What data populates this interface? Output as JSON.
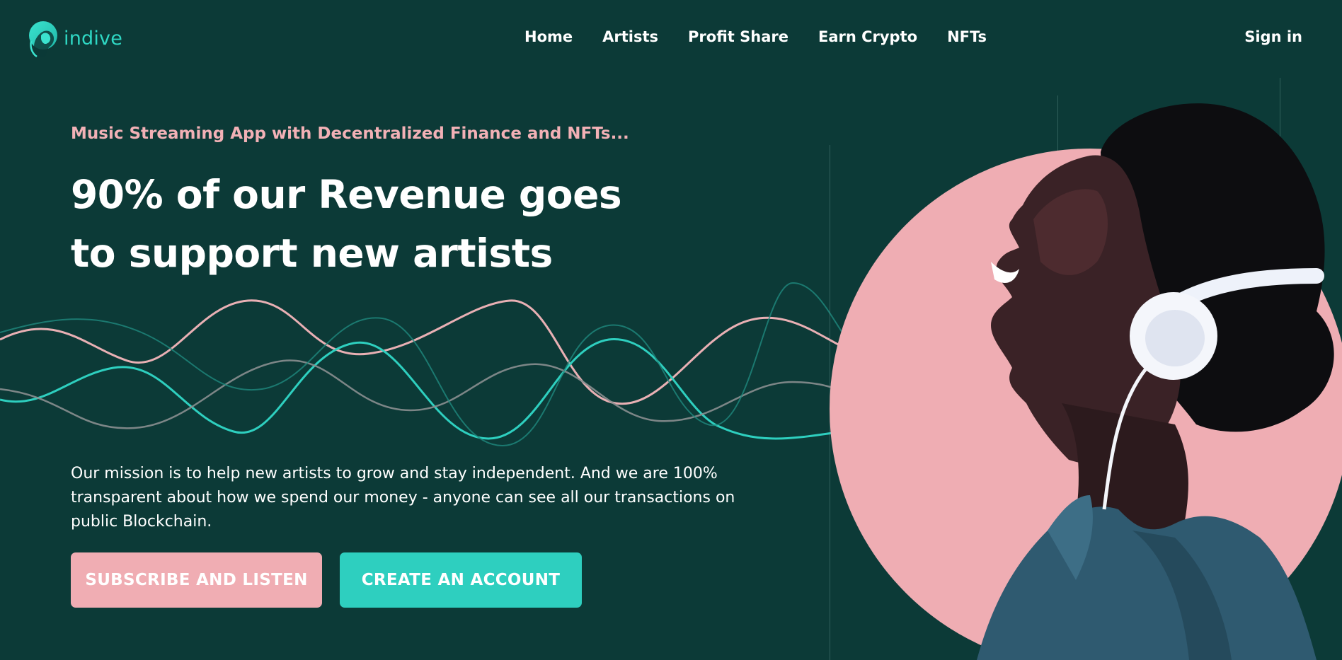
{
  "brand": {
    "name": "indive",
    "accent": "#2fd8c4",
    "pink": "#f0adb3",
    "background": "#0c3a37"
  },
  "nav": {
    "items": [
      {
        "label": "Home"
      },
      {
        "label": "Artists"
      },
      {
        "label": "Profit Share"
      },
      {
        "label": "Earn Crypto"
      },
      {
        "label": "NFTs"
      }
    ],
    "signin": "Sign in"
  },
  "hero": {
    "tagline": "Music Streaming App with Decentralized Finance and NFTs...",
    "headline": "90% of our Revenue goes to support new artists",
    "mission": "Our mission is to help new artists to grow and stay independent. And we are 100% transparent about how we spend our money - anyone can see all our transactions on public Blockchain.",
    "buttons": {
      "subscribe": "SUBSCRIBE AND LISTEN",
      "create": "CREATE AN ACCOUNT"
    }
  },
  "icons": {
    "logo": "woman-head-silhouette-icon",
    "hero_image": "man-with-headphones-illustration"
  }
}
